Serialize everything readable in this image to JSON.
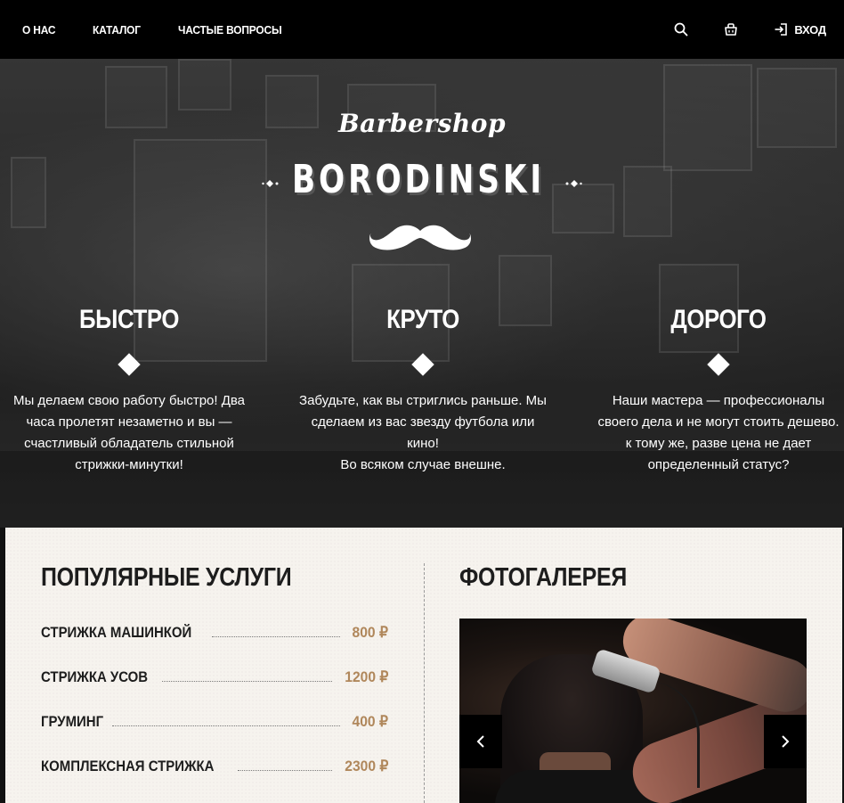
{
  "nav": {
    "links": [
      "О НАС",
      "КАТАЛОГ",
      "ЧАСТЫЕ ВОПРОСЫ"
    ],
    "search_icon": "search-icon",
    "cart_icon": "basket-icon",
    "login_label": "ВХОД",
    "login_icon": "login-icon"
  },
  "hero": {
    "logo_script": "Barbershop",
    "logo_main": "BORODINSKI",
    "logo_icon": "mustache-icon",
    "features": [
      {
        "title": "БЫСТРО",
        "text": "Мы делаем свою работу быстро! Два\nчаса пролетят незаметно и вы —\nсчастливый обладатель стильной\nстрижки-минутки!"
      },
      {
        "title": "КРУТО",
        "text": "Забудьте, как вы стриглись раньше. Мы\nсделаем из вас звезду футбола или\nкино!\nВо всяком случае внешне."
      },
      {
        "title": "ДОРОГО",
        "text": "Наши мастера — профессионалы\nсвоего дела и не могут стоить дешево.\nк тому же, разве цена не дает\nопределенный статус?"
      }
    ]
  },
  "services": {
    "title": "ПОПУЛЯРНЫЕ УСЛУГИ",
    "items": [
      {
        "name": "СТРИЖКА МАШИНКОЙ",
        "price": "800 ₽"
      },
      {
        "name": "СТРИЖКА УСОВ",
        "price": "1200 ₽"
      },
      {
        "name": "ГРУМИНГ",
        "price": "400 ₽"
      },
      {
        "name": "КОМПЛЕКСНАЯ СТРИЖКА",
        "price": "2300 ₽"
      }
    ]
  },
  "gallery": {
    "title": "ФОТОГАЛЕРЕЯ",
    "prev_icon": "chevron-left-icon",
    "next_icon": "chevron-right-icon"
  },
  "colors": {
    "nav_bg": "#000000",
    "price": "#b0875b",
    "content_bg": "#f6f3ee"
  }
}
